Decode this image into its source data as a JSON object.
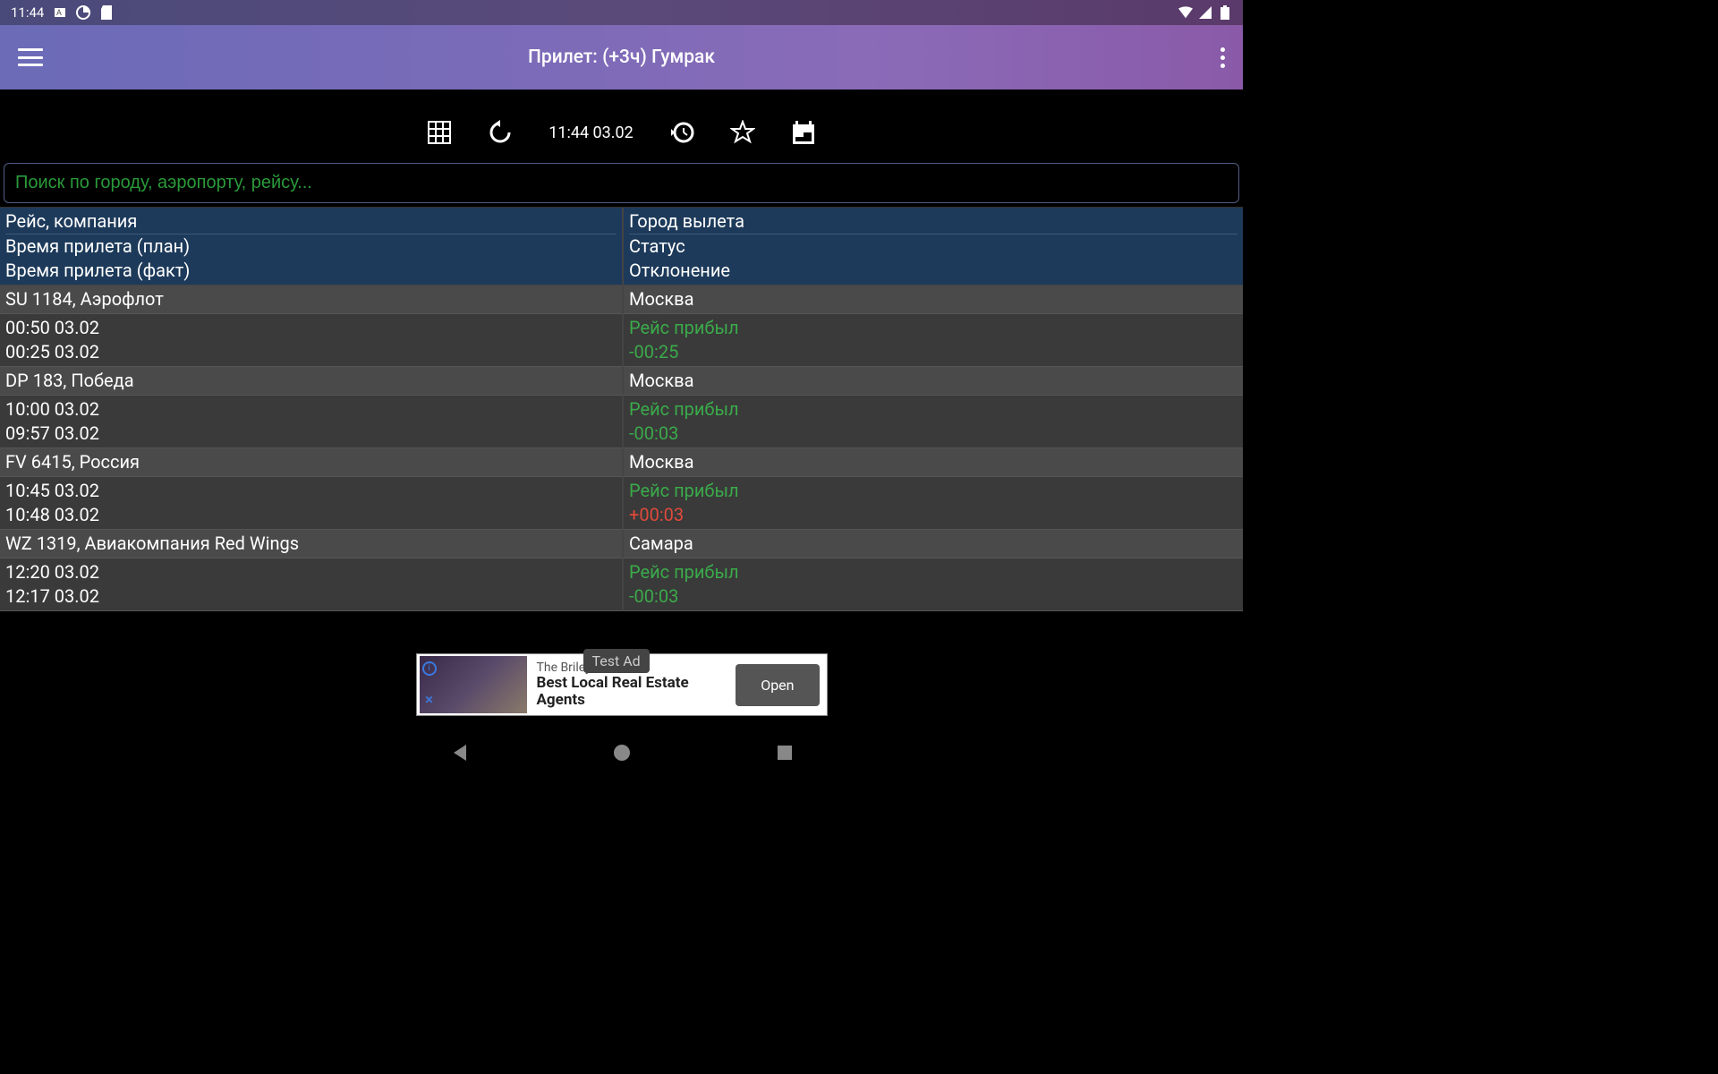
{
  "status_bar": {
    "time": "11:44"
  },
  "app_bar": {
    "title": "Прилет: (+3ч) Гумрак"
  },
  "toolbar": {
    "datetime": "11:44 03.02"
  },
  "search": {
    "placeholder": "Поиск по городу, аэропорту, рейсу..."
  },
  "table_headers": {
    "flight_company": "Рейс, компания",
    "departure_city": "Город вылета",
    "arrival_plan": "Время прилета (план)",
    "arrival_fact": "Время прилета (факт)",
    "status": "Статус",
    "deviation": "Отклонение"
  },
  "flights": [
    {
      "flight": "SU 1184, Аэрофлот",
      "city": "Москва",
      "plan": "00:50 03.02",
      "fact": "00:25 03.02",
      "status": "Рейс прибыл",
      "deviation": "-00:25",
      "dev_class": "status-green"
    },
    {
      "flight": "DP 183, Победа",
      "city": "Москва",
      "plan": "10:00 03.02",
      "fact": "09:57 03.02",
      "status": "Рейс прибыл",
      "deviation": "-00:03",
      "dev_class": "status-green"
    },
    {
      "flight": "FV 6415, Россия",
      "city": "Москва",
      "plan": "10:45 03.02",
      "fact": "10:48 03.02",
      "status": "Рейс прибыл",
      "deviation": "+00:03",
      "dev_class": "status-red"
    },
    {
      "flight": "WZ 1319, Авиакомпания Red Wings",
      "city": "Самара",
      "plan": "12:20 03.02",
      "fact": "12:17 03.02",
      "status": "Рейс прибыл",
      "deviation": "-00:03",
      "dev_class": "status-green"
    }
  ],
  "ad": {
    "badge": "Test Ad",
    "line1": "The Briley",
    "line2": "Best Local Real Estate Agents",
    "cta": "Open"
  }
}
